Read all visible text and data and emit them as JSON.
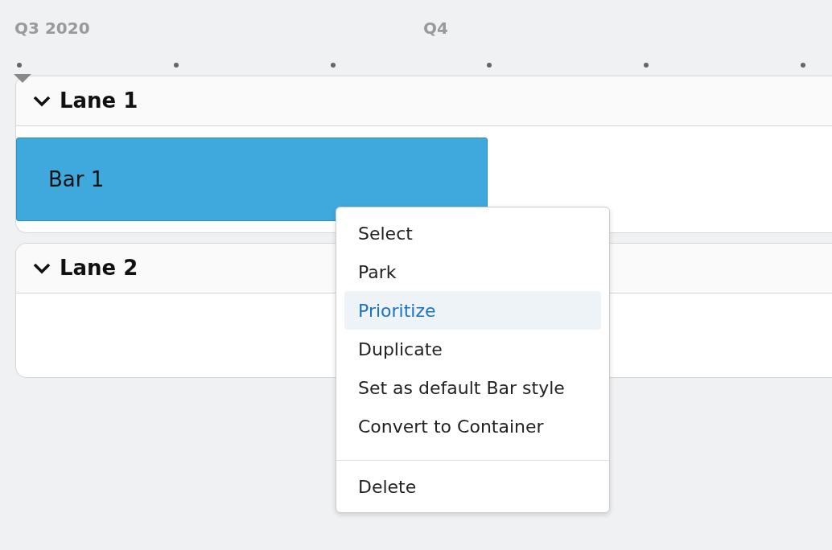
{
  "timeline": {
    "quarters": [
      {
        "label": "Q3 2020"
      },
      {
        "label": "Q4"
      }
    ]
  },
  "lanes": [
    {
      "title": "Lane 1",
      "expanded": true,
      "bars": [
        {
          "label": "Bar 1"
        }
      ]
    },
    {
      "title": "Lane 2",
      "expanded": true
    }
  ],
  "context_menu": {
    "groups": [
      [
        {
          "label": "Select",
          "selected": false
        },
        {
          "label": "Park",
          "selected": false
        },
        {
          "label": "Prioritize",
          "selected": true
        },
        {
          "label": "Duplicate",
          "selected": false
        },
        {
          "label": "Set as default Bar style",
          "selected": false
        },
        {
          "label": "Convert to Container",
          "selected": false
        }
      ],
      [
        {
          "label": "Delete",
          "selected": false
        }
      ]
    ]
  }
}
